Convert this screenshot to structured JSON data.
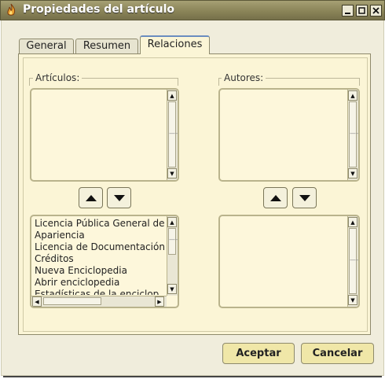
{
  "window": {
    "title": "Propiedades del artículo",
    "icon": "app-flame-icon",
    "controls": [
      "minimize-icon",
      "maximize-icon",
      "close-icon"
    ]
  },
  "tabs": [
    {
      "label": "General",
      "active": false
    },
    {
      "label": "Resumen",
      "active": false
    },
    {
      "label": "Relaciones",
      "active": true
    }
  ],
  "relaciones": {
    "articulos_label": "Artículos:",
    "autores_label": "Autores:",
    "articulos_selected": [],
    "autores_selected": [],
    "available_articles": [
      "Licencia Pública General de",
      "Apariencia",
      "Licencia de Documentación",
      "Créditos",
      "Nueva Enciclopedia",
      "Abrir enciclopedia",
      "Estadísticas de la enciclop"
    ],
    "available_authors": []
  },
  "buttons": {
    "accept": "Aceptar",
    "cancel": "Cancelar"
  },
  "colors": {
    "titlebar": "#8a8458",
    "panel": "#fbf5d6",
    "button": "#f0e7a8",
    "active_tab_accent": "#6a8dc0"
  }
}
